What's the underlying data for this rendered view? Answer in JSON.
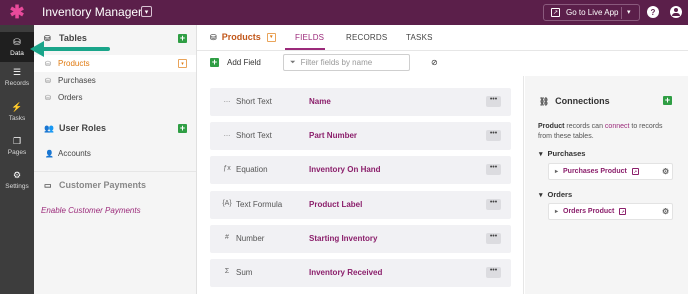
{
  "topbar": {
    "logo_glyph": "✱",
    "app_title": "Inventory Manager",
    "live_app_label": "Go to Live App",
    "help_glyph": "?"
  },
  "leftnav": {
    "items": [
      {
        "label": "Data",
        "icon": "database-icon",
        "glyph": "⛁",
        "active": true
      },
      {
        "label": "Records",
        "icon": "records-icon",
        "glyph": "☰",
        "active": false
      },
      {
        "label": "Tasks",
        "icon": "bolt-icon",
        "glyph": "⚡",
        "active": false
      },
      {
        "label": "Pages",
        "icon": "pages-icon",
        "glyph": "❐",
        "active": false
      },
      {
        "label": "Settings",
        "icon": "gear-icon",
        "glyph": "⚙",
        "active": false
      }
    ]
  },
  "tables_panel": {
    "tables_header": "Tables",
    "tables": [
      {
        "label": "Products",
        "active": true
      },
      {
        "label": "Purchases",
        "active": false
      },
      {
        "label": "Orders",
        "active": false
      }
    ],
    "user_roles_header": "User Roles",
    "user_roles": [
      {
        "label": "Accounts"
      }
    ],
    "payments_header": "Customer Payments",
    "enable_payments_link": "Enable Customer Payments"
  },
  "main": {
    "object_title": "Products",
    "tabs": [
      {
        "label": "FIELDS",
        "active": true
      },
      {
        "label": "RECORDS",
        "active": false
      },
      {
        "label": "TASKS",
        "active": false
      }
    ],
    "add_field_label": "Add Field",
    "filter_placeholder": "Filter fields by name",
    "fields": [
      {
        "type": "Short Text",
        "type_glyph": "…",
        "type_icon": "short-text-icon",
        "name": "Name"
      },
      {
        "type": "Short Text",
        "type_glyph": "…",
        "type_icon": "short-text-icon",
        "name": "Part Number"
      },
      {
        "type": "Equation",
        "type_glyph": "ƒx",
        "type_icon": "equation-icon",
        "name": "Inventory On Hand"
      },
      {
        "type": "Text Formula",
        "type_glyph": "{A}",
        "type_icon": "text-formula-icon",
        "name": "Product Label"
      },
      {
        "type": "Number",
        "type_glyph": "#",
        "type_icon": "number-icon",
        "name": "Starting Inventory"
      },
      {
        "type": "Sum",
        "type_glyph": "Σ",
        "type_icon": "sum-icon",
        "name": "Inventory Received"
      }
    ],
    "more_glyph": "•••"
  },
  "connections": {
    "title": "Connections",
    "desc_object": "Product",
    "desc_mid": " records can ",
    "desc_link": "connect",
    "desc_end": " to records from these tables.",
    "groups": [
      {
        "label": "Purchases",
        "item": "Purchases Product"
      },
      {
        "label": "Orders",
        "item": "Orders Product"
      }
    ]
  },
  "colors": {
    "topbar": "#5b1f4a",
    "accent": "#9b2a7a",
    "active_table": "#e07a10",
    "add_green": "#2f9e44",
    "annotation_arrow": "#1aa58a"
  }
}
